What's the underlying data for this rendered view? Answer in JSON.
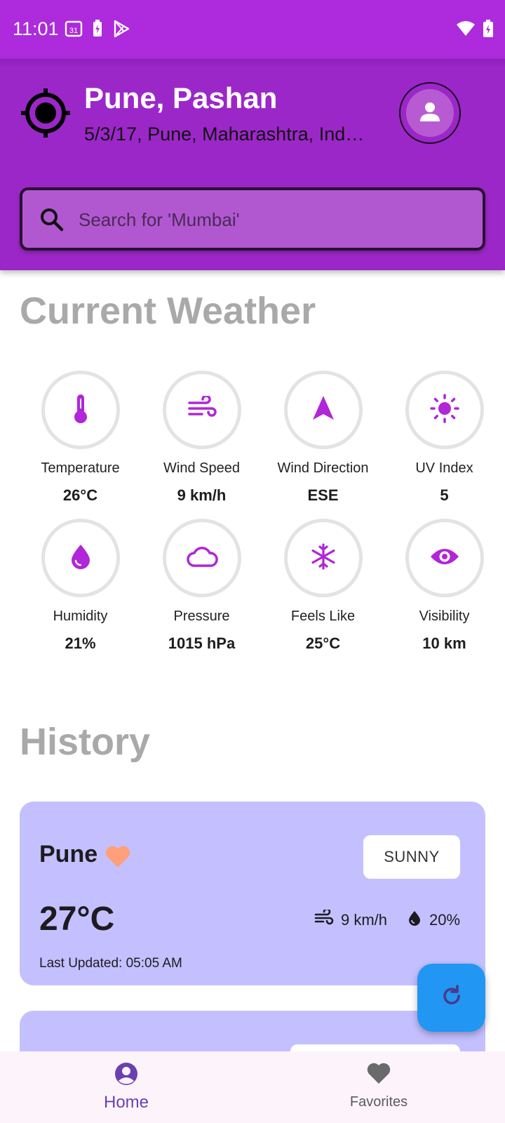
{
  "status_bar": {
    "time": "11:01",
    "calendar_day": "31",
    "left_icons": [
      "calendar-icon",
      "battery-saver-icon",
      "play-store-icon"
    ],
    "right_icons": [
      "wifi-icon",
      "battery-charging-icon"
    ]
  },
  "header": {
    "title": "Pune, Pashan",
    "subtitle": "5/3/17, Pune, Maharashtra, Ind…",
    "locate_icon": "my-location-icon",
    "profile_icon": "person-icon"
  },
  "search": {
    "placeholder": "Search for 'Mumbai'",
    "value": ""
  },
  "current_weather": {
    "title": "Current Weather",
    "metrics": [
      {
        "label": "Temperature",
        "value": "26°C",
        "icon": "thermometer-icon"
      },
      {
        "label": "Wind Speed",
        "value": "9 km/h",
        "icon": "wind-icon"
      },
      {
        "label": "Wind Direction",
        "value": "ESE",
        "icon": "navigation-arrow-icon"
      },
      {
        "label": "UV Index",
        "value": "5",
        "icon": "sun-icon"
      },
      {
        "label": "Humidity",
        "value": "21%",
        "icon": "water-drop-icon"
      },
      {
        "label": "Pressure",
        "value": "1015 hPa",
        "icon": "cloud-icon"
      },
      {
        "label": "Feels Like",
        "value": "25°C",
        "icon": "snowflake-icon"
      },
      {
        "label": "Visibility",
        "value": "10 km",
        "icon": "eye-icon"
      }
    ]
  },
  "history": {
    "title": "History",
    "cards": [
      {
        "city": "Pune",
        "favorite": true,
        "condition": "SUNNY",
        "temperature": "27°C",
        "wind": "9 km/h",
        "humidity": "20%",
        "updated": "Last Updated: 05:05 AM"
      }
    ]
  },
  "fab": {
    "icon": "refresh-icon"
  },
  "bottom_nav": {
    "items": [
      {
        "label": "Home",
        "icon": "account-circle-icon",
        "active": true
      },
      {
        "label": "Favorites",
        "icon": "heart-icon",
        "active": false
      }
    ]
  },
  "colors": {
    "status_bar": "#ad2bdc",
    "header": "#9c27c8",
    "accent_icon": "#b026d8",
    "card": "#c4c0ff",
    "fab": "#2196f3",
    "favorite_heart": "#ffa07a",
    "nav_active": "#6a3fb0"
  }
}
